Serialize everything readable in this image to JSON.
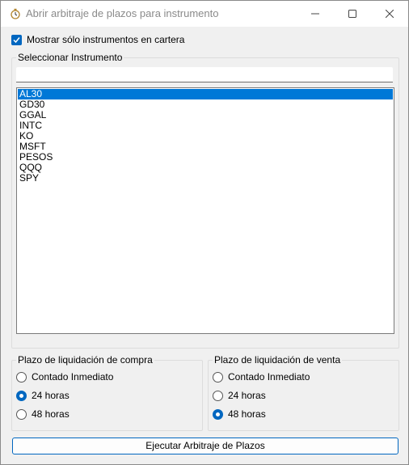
{
  "window": {
    "title": "Abrir arbitraje de plazos para instrumento",
    "icon": "stopwatch-icon",
    "controls": [
      "minimize-icon",
      "maximize-icon",
      "close-icon"
    ]
  },
  "filter": {
    "label": "Mostrar sólo instrumentos en cartera",
    "checked": true
  },
  "instrument_group": {
    "title": "Seleccionar Instrumento",
    "search_value": "",
    "items": [
      "AL30",
      "GD30",
      "GGAL",
      "INTC",
      "KO",
      "MSFT",
      "PESOS",
      "QQQ",
      "SPY"
    ],
    "selected": "AL30"
  },
  "buy_settlement": {
    "title": "Plazo de liquidación de compra",
    "options": [
      "Contado Inmediato",
      "24 horas",
      "48 horas"
    ],
    "selected": "24 horas"
  },
  "sell_settlement": {
    "title": "Plazo de liquidación de venta",
    "options": [
      "Contado Inmediato",
      "24 horas",
      "48 horas"
    ],
    "selected": "48 horas"
  },
  "execute_button": {
    "label": "Ejecutar Arbitraje de Plazos"
  },
  "colors": {
    "accent": "#0067c0",
    "selection": "#0078d7",
    "window_bg": "#f0f0f0"
  }
}
